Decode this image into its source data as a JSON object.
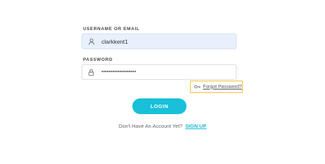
{
  "form": {
    "username_label": "USERNAME OR EMAIL",
    "username_value": "clarkkent1",
    "password_label": "PASSWORD",
    "password_value": "•••••••••••••••••••",
    "forgot_label": "Forgot Password?",
    "login_label": "LOGIN",
    "signup_prompt": "Don't Have An Account Yet?",
    "signup_label": "SIGN UP"
  },
  "icons": {
    "username": "user-icon",
    "password": "lock-icon",
    "forgot": "key-icon"
  },
  "colors": {
    "accent": "#18c0d8",
    "link": "#18b9d3",
    "highlight_border": "#f1c232",
    "autofill_background": "#e8f0fe"
  }
}
